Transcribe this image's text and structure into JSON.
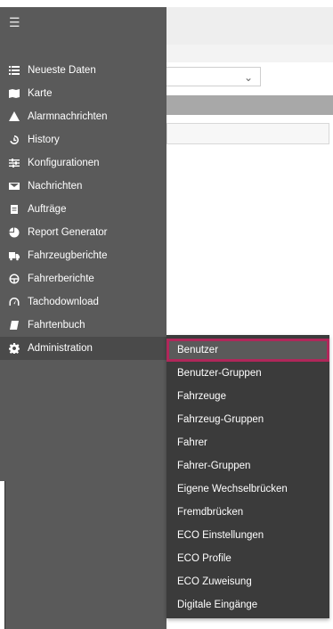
{
  "sidebar": {
    "menu_icon": "hamburger-icon",
    "items": [
      {
        "label": "Neueste Daten",
        "icon": "list-icon"
      },
      {
        "label": "Karte",
        "icon": "map-icon"
      },
      {
        "label": "Alarmnachrichten",
        "icon": "warning-icon"
      },
      {
        "label": "History",
        "icon": "history-icon"
      },
      {
        "label": "Konfigurationen",
        "icon": "sliders-icon"
      },
      {
        "label": "Nachrichten",
        "icon": "envelope-icon"
      },
      {
        "label": "Aufträge",
        "icon": "clipboard-icon"
      },
      {
        "label": "Report Generator",
        "icon": "pie-chart-icon"
      },
      {
        "label": "Fahrzeugberichte",
        "icon": "truck-icon"
      },
      {
        "label": "Fahrerberichte",
        "icon": "steering-wheel-icon"
      },
      {
        "label": "Tachodownload",
        "icon": "gauge-icon"
      },
      {
        "label": "Fahrtenbuch",
        "icon": "book-icon"
      },
      {
        "label": "Administration",
        "icon": "gear-icon"
      }
    ]
  },
  "submenu": {
    "items": [
      {
        "label": "Benutzer"
      },
      {
        "label": "Benutzer-Gruppen"
      },
      {
        "label": "Fahrzeuge"
      },
      {
        "label": "Fahrzeug-Gruppen"
      },
      {
        "label": "Fahrer"
      },
      {
        "label": "Fahrer-Gruppen"
      },
      {
        "label": "Eigene Wechselbrücken"
      },
      {
        "label": "Fremdbrücken"
      },
      {
        "label": "ECO Einstellungen"
      },
      {
        "label": "ECO Profile"
      },
      {
        "label": "ECO Zuweisung"
      },
      {
        "label": "Digitale Eingänge"
      }
    ],
    "highlight_color": "#b0275a"
  },
  "colors": {
    "sidebar_bg": "#5a5a5a",
    "submenu_bg": "#3b3b3b"
  }
}
